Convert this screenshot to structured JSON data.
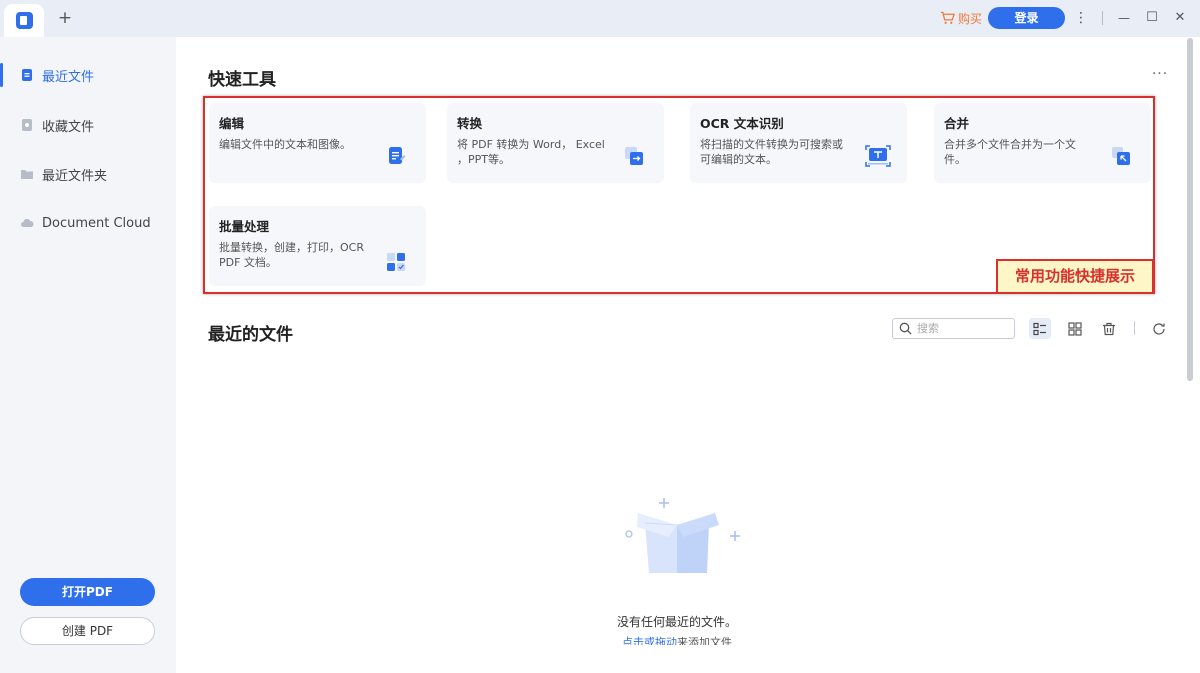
{
  "titlebar": {
    "new_tab": "+",
    "buy_label": "购买",
    "login_label": "登录",
    "more": "⋮",
    "minimize": "—",
    "maximize": "☐",
    "close": "✕"
  },
  "sidebar": {
    "items": [
      {
        "label": "最近文件",
        "icon": "recent-file-icon"
      },
      {
        "label": "收藏文件",
        "icon": "star-file-icon"
      },
      {
        "label": "最近文件夹",
        "icon": "folder-icon"
      },
      {
        "label": "Document Cloud",
        "icon": "cloud-icon"
      }
    ],
    "open_pdf": "打开PDF",
    "create_pdf": "创建 PDF"
  },
  "quick_tools": {
    "title": "快速工具",
    "more": "···",
    "tools": [
      {
        "title": "编辑",
        "desc": "编辑文件中的文本和图像。",
        "icon": "edit-doc-icon"
      },
      {
        "title": "转换",
        "desc": "将 PDF 转换为 Word， Excel ，PPT等。",
        "icon": "convert-icon"
      },
      {
        "title": "OCR 文本识别",
        "desc": "将扫描的文件转换为可搜索或可编辑的文本。",
        "icon": "ocr-scan-icon"
      },
      {
        "title": "合并",
        "desc": "合并多个文件合并为一个文件。",
        "icon": "merge-icon"
      },
      {
        "title": "批量处理",
        "desc": "批量转换，创建，打印，OCR PDF 文档。",
        "icon": "batch-icon"
      }
    ],
    "callout": "常用功能快捷展示"
  },
  "recent": {
    "title": "最近的文件",
    "search_placeholder": "搜索",
    "empty_text": "没有任何最近的文件。",
    "hint_link": "点击或拖动",
    "hint_rest": "来添加文件"
  },
  "colors": {
    "accent": "#2f6fec",
    "annotation_red": "#d9302c",
    "buy_orange": "#f07a3a"
  }
}
